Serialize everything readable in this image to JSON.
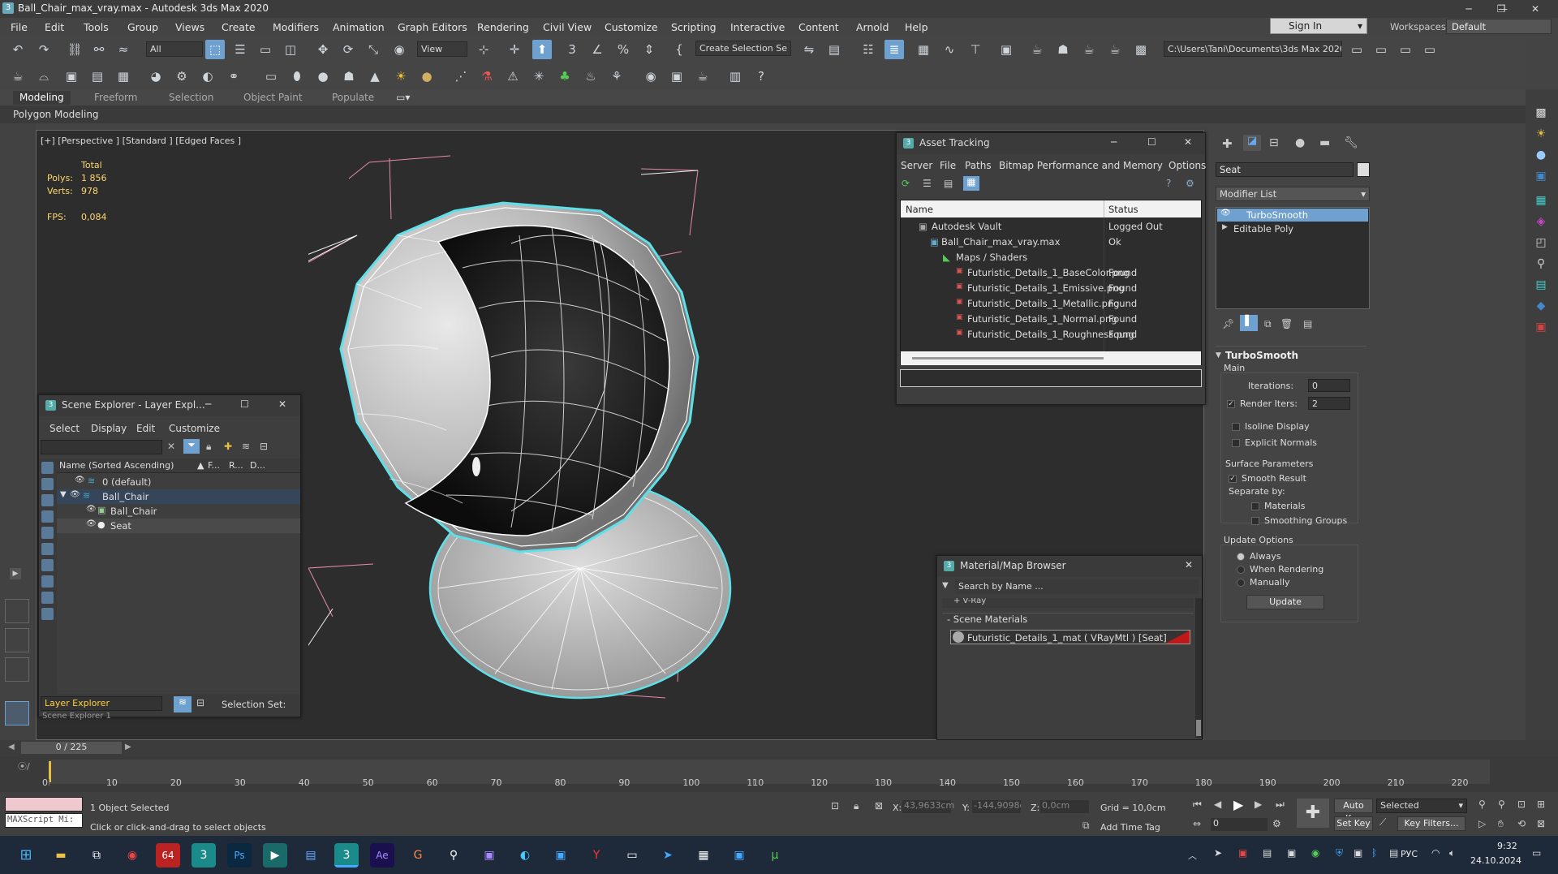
{
  "window": {
    "title": "Ball_Chair_max_vray.max - Autodesk 3ds Max 2020"
  },
  "menu": [
    "File",
    "Edit",
    "Tools",
    "Group",
    "Views",
    "Create",
    "Modifiers",
    "Animation",
    "Graph Editors",
    "Rendering",
    "Civil View",
    "Customize",
    "Scripting",
    "Interactive",
    "Content",
    "Arnold",
    "Help"
  ],
  "account": {
    "signin": "Sign In",
    "workspaces_label": "Workspaces:",
    "workspace": "Default"
  },
  "toolbar": {
    "filter": "All",
    "refcoord": "View",
    "selset": "Create Selection Se",
    "path": "C:\\Users\\Tani\\Documents\\3ds Max 2020"
  },
  "ribbon": {
    "tabs": [
      "Modeling",
      "Freeform",
      "Selection",
      "Object Paint",
      "Populate"
    ],
    "sub": "Polygon Modeling"
  },
  "viewport": {
    "label": "[+] [Perspective ] [Standard ] [Edged Faces ]",
    "stats": {
      "total": "Total",
      "polys_label": "Polys:",
      "polys": "1 856",
      "verts_label": "Verts:",
      "verts": "978",
      "fps_label": "FPS:",
      "fps": "0,084"
    }
  },
  "asset_tracking": {
    "title": "Asset Tracking",
    "menu": [
      "Server",
      "File",
      "Paths",
      "Bitmap Performance and Memory",
      "Options"
    ],
    "col_name": "Name",
    "col_status": "Status",
    "rows": [
      {
        "name": "Autodesk Vault",
        "status": "Logged Out"
      },
      {
        "name": "Ball_Chair_max_vray.max",
        "status": "Ok"
      },
      {
        "name": "Maps / Shaders",
        "status": ""
      },
      {
        "name": "Futuristic_Details_1_BaseColor.png",
        "status": "Found"
      },
      {
        "name": "Futuristic_Details_1_Emissive.png",
        "status": "Found"
      },
      {
        "name": "Futuristic_Details_1_Metallic.png",
        "status": "Found"
      },
      {
        "name": "Futuristic_Details_1_Normal.png",
        "status": "Found"
      },
      {
        "name": "Futuristic_Details_1_Roughness.png",
        "status": "Found"
      }
    ]
  },
  "scene_explorer": {
    "title": "Scene Explorer - Layer Expl...",
    "menu": [
      "Select",
      "Display",
      "Edit",
      "Customize"
    ],
    "col_name": "Name (Sorted Ascending)",
    "col_f": "F...",
    "col_r": "R...",
    "col_d": "D...",
    "rows": [
      "0 (default)",
      "Ball_Chair",
      "Ball_Chair",
      "Seat"
    ],
    "footer_combo": "Layer Explorer",
    "footer_combo2": "Scene Explorer 1",
    "selection_set": "Selection Set:"
  },
  "material_browser": {
    "title": "Material/Map Browser",
    "search": "Search by Name ...",
    "vray": "+ V-Ray",
    "scene_materials": "- Scene Materials",
    "material": "Futuristic_Details_1_mat  ( VRayMtl ) [Seat]"
  },
  "command_panel": {
    "object_name": "Seat",
    "modifier_list": "Modifier List",
    "stack": [
      "TurboSmooth",
      "Editable Poly"
    ],
    "turbosmooth": {
      "title": "TurboSmooth",
      "main": "Main",
      "iterations_label": "Iterations:",
      "iterations": "0",
      "render_iters_label": "Render Iters:",
      "render_iters": "2",
      "isoline": "Isoline Display",
      "explicit": "Explicit Normals",
      "surface": "Surface Parameters",
      "smooth": "Smooth Result",
      "separate": "Separate by:",
      "materials": "Materials",
      "smoothing": "Smoothing Groups",
      "update_options": "Update Options",
      "always": "Always",
      "when_rendering": "When Rendering",
      "manually": "Manually",
      "update": "Update"
    }
  },
  "timeline": {
    "frame": "0 / 225",
    "ticks": [
      "0",
      "10",
      "20",
      "30",
      "40",
      "50",
      "60",
      "70",
      "80",
      "90",
      "100",
      "110",
      "120",
      "130",
      "140",
      "150",
      "160",
      "170",
      "180",
      "190",
      "200",
      "210",
      "220"
    ]
  },
  "status": {
    "maxscript": "MAXScript Mi:",
    "selected": "1 Object Selected",
    "prompt": "Click or click-and-drag to select objects",
    "x_label": "X:",
    "x": "43,9633cm",
    "y_label": "Y:",
    "y": "-144,9098c",
    "z_label": "Z:",
    "z": "0,0cm",
    "grid": "Grid = 10,0cm",
    "add_time_tag": "Add Time Tag",
    "auto_key": "Auto Key",
    "selected_dd": "Selected",
    "set_key": "Set Key",
    "key_filters": "Key Filters...",
    "frame_field": "0"
  },
  "taskbar": {
    "lang": "РУС",
    "time": "9:32",
    "date": "24.10.2024",
    "icons": [
      "start-icon",
      "explorer-icon",
      "taskview-icon",
      "chrome-icon",
      "64-icon",
      "3dsmax-icon",
      "photoshop-icon",
      "app-icon",
      "notepad-icon",
      "3dsmax-active-icon",
      "aftereffects-icon",
      "g-icon",
      "magnifier-icon",
      "save-icon",
      "edge-icon",
      "store-icon",
      "yandex-icon",
      "terminal-icon",
      "telegram-icon",
      "calculator-icon",
      "window-icon",
      "utorrent-icon"
    ]
  }
}
